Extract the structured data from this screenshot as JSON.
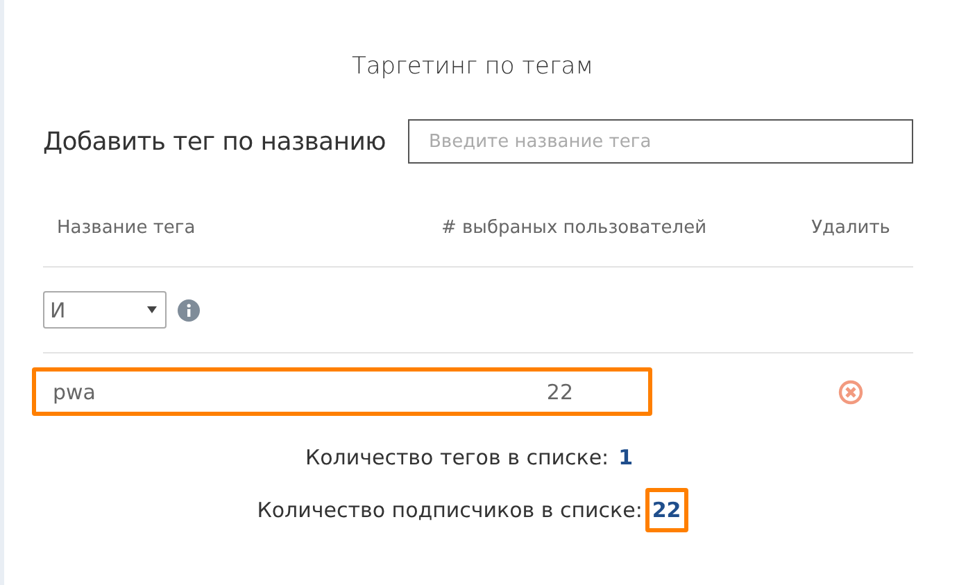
{
  "title": "Таргетинг по тегам",
  "add_tag": {
    "label": "Добавить тег по названию",
    "placeholder": "Введите название тега"
  },
  "table": {
    "columns": [
      "Название тега",
      "# выбраных пользователей",
      "Удалить"
    ],
    "operator": {
      "value": "И"
    },
    "rows": [
      {
        "name": "pwa",
        "users": "22",
        "highlighted": true
      }
    ]
  },
  "summary": [
    {
      "label": "Количество тегов в списке:",
      "value": "1",
      "highlighted": false
    },
    {
      "label": "Количество подписчиков в списке:",
      "value": "22",
      "highlighted": true
    }
  ]
}
